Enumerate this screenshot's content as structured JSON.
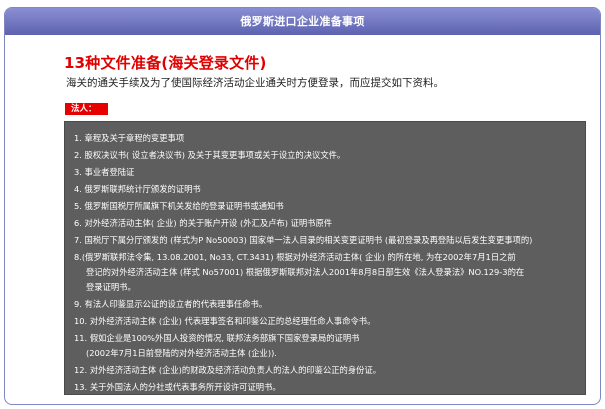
{
  "header": {
    "title": "俄罗斯进口企业准备事项"
  },
  "section": {
    "title": "13种文件准备(海关登录文件)",
    "subtitle": "海关的通关手续及为了使国际经济活动企业通关时方便登录，而应提交如下资料。",
    "badge": "法人："
  },
  "colors": {
    "header_bg": "#6a6fc0",
    "title_red": "#e00000",
    "badge_bg": "#e60000",
    "list_bg": "#5e5e5e"
  },
  "items": [
    {
      "lines": [
        "1. 章程及关于章程的变更事项"
      ]
    },
    {
      "lines": [
        "2. 股权决议书( 设立者决议书) 及关于其变更事项或关于设立的决议文件。"
      ]
    },
    {
      "lines": [
        "3. 事业者登陆证"
      ]
    },
    {
      "lines": [
        "4. 俄罗斯联邦统计厅颁发的证明书"
      ]
    },
    {
      "lines": [
        "5. 俄罗斯国税厅所属旗下机关发给的登录证明书或通知书"
      ]
    },
    {
      "lines": [
        "6. 对外经济活动主体( 企业) 的关于账户开设 (外汇及卢布) 证明书原件"
      ]
    },
    {
      "lines": [
        "7. 国税厅下属分厅颁发的 (样式为P No50003) 国家单一法人目录的相关变更证明书 (最初登录及再登陆以后发生变更事项的)"
      ]
    },
    {
      "lines": [
        "8.(俄罗斯联邦法令集, 13.08.2001, No33, CT.3431) 根据对外经济活动主体( 企业) 的所在地, 为在2002年7月1日之前",
        "登记的对外经济活动主体 (样式 No57001) 根据俄罗斯联邦对法人2001年8月8日部生效《法人登录法》NO.129-3的在",
        "登录证明书。"
      ]
    },
    {
      "lines": [
        "9. 有法人印鉴显示公证的设立者的代表理事任命书。"
      ]
    },
    {
      "lines": [
        "10. 对外经济活动主体 (企业) 代表理事签名和印鉴公正的总经理任命人事命令书。"
      ]
    },
    {
      "lines": [
        "11. 假如企业是100%外国人投资的情况, 联邦法务部旗下国家登录局的证明书",
        "(2002年7月1日前登陆的对外经济活动主体 (企业))."
      ]
    },
    {
      "lines": [
        "12. 对外经济活动主体 (企业)的财政及经济活动负责人的法人的印鉴公正的身份证。"
      ]
    },
    {
      "lines": [
        "13. 关于外国法人的分社或代表事务所开设许可证明书。"
      ]
    }
  ]
}
